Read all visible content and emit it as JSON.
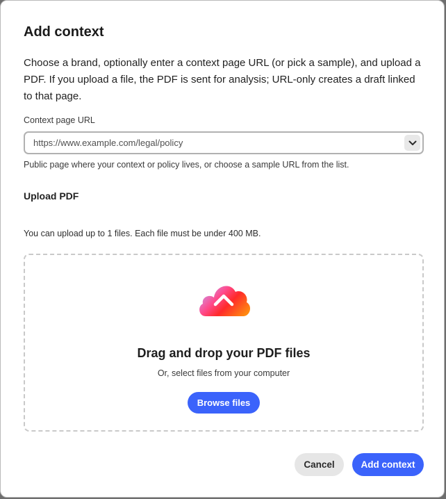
{
  "dialog": {
    "title": "Add context",
    "description": "Choose a brand, optionally enter a context page URL (or pick a sample), and upload a PDF. If you upload a file, the PDF is sent for analysis; URL-only creates a draft linked to that page."
  },
  "context_url": {
    "label": "Context page URL",
    "value": "https://www.example.com/legal/policy",
    "help": "Public page where your context or policy lives, or choose a sample URL from the list.",
    "dropdown_icon": "chevron-down-icon"
  },
  "upload": {
    "section_title": "Upload PDF",
    "limit_text": "You can upload up to 1 files. Each file must be under 400 MB.",
    "dropzone_icon": "cloud-upload-icon",
    "dropzone_title": "Drag and drop your PDF files",
    "dropzone_subtitle": "Or, select files from your computer",
    "browse_label": "Browse files"
  },
  "footer": {
    "cancel_label": "Cancel",
    "submit_label": "Add context"
  },
  "colors": {
    "accent": "#3b63fb",
    "secondary_button": "#e6e6e6"
  }
}
